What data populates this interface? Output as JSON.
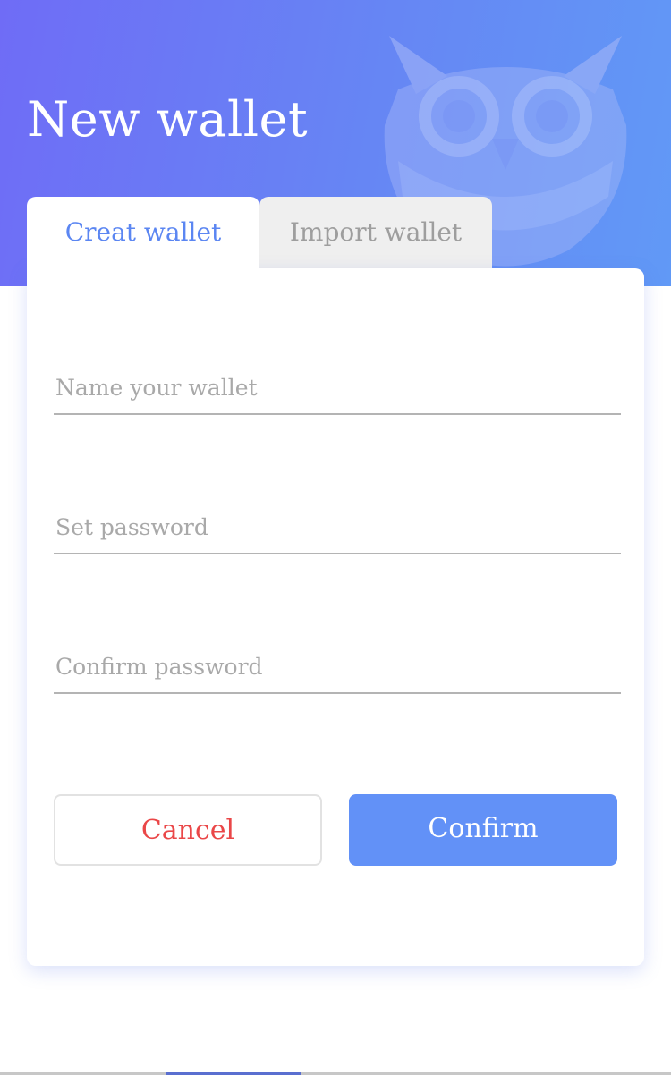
{
  "header": {
    "title": "New wallet",
    "background_gradient": [
      "#6f6cf6",
      "#6199f6"
    ],
    "watermark_icon": "owl-logo-icon"
  },
  "tabs": [
    {
      "label": "Creat wallet",
      "active": true
    },
    {
      "label": "Import wallet",
      "active": false
    }
  ],
  "form": {
    "wallet_name": {
      "value": "",
      "placeholder": "Name your wallet"
    },
    "password": {
      "value": "",
      "placeholder": "Set password"
    },
    "confirm_password": {
      "value": "",
      "placeholder": "Confirm password"
    }
  },
  "actions": {
    "cancel_label": "Cancel",
    "confirm_label": "Confirm"
  },
  "colors": {
    "accent": "#6291f7",
    "active_tab_text": "#5b86f2",
    "cancel_text": "#ea4748",
    "inactive_tab_bg": "#efefef"
  }
}
